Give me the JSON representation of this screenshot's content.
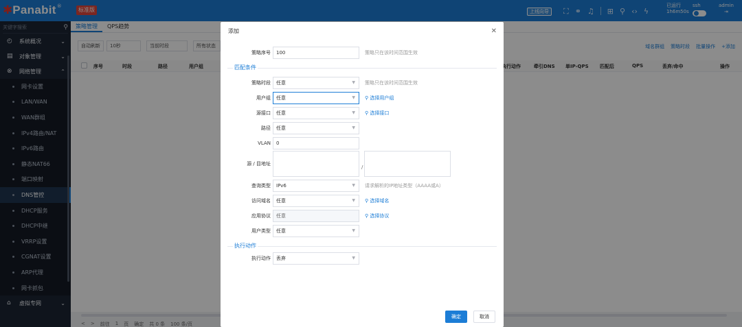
{
  "topbar": {
    "brand": "Panabit",
    "edition": "标准版",
    "guide": "上线向导",
    "icons": [
      "expand-icon",
      "link-icon",
      "bell-icon",
      "apps-icon",
      "user-group-icon",
      "code-icon",
      "flash-icon"
    ],
    "runtime_label": "已运行",
    "runtime_value": "1h6m50s",
    "ssh_label": "ssh",
    "user": "admin",
    "colors": {
      "bar": "#1c7dd6",
      "edition_badge": "#e0463c",
      "logo_star": "#e6372f"
    }
  },
  "sidebar": {
    "search_placeholder": "关键字搜索",
    "groups": [
      {
        "label": "系统概况",
        "icon": "dashboard-icon"
      },
      {
        "label": "对象管理",
        "icon": "database-icon"
      },
      {
        "label": "网络管理",
        "icon": "network-icon"
      }
    ],
    "items": [
      "网卡设置",
      "LAN/WAN",
      "WAN群组",
      "IPv4路由/NAT",
      "IPv6路由",
      "静态NAT66",
      "端口映射",
      "DNS管控",
      "DHCP服务",
      "DHCP中继",
      "VRRP设置",
      "CGNAT设置",
      "ARP代理",
      "网卡抓包"
    ],
    "active_item": "DNS管控",
    "bottom_group": {
      "label": "虚拟专网",
      "icon": "vpn-icon"
    }
  },
  "main": {
    "tabs": [
      "策略管理",
      "QPS趋势"
    ],
    "toolbar": {
      "auto_refresh": "自动刷新",
      "interval": "10秒",
      "time_filter": "当前时段",
      "status_filter": "所有状态",
      "domain_group": "域名群组",
      "policy_period": "策略时段",
      "batch": "批量操作",
      "add": "+添加"
    },
    "columns": [
      "序号",
      "时段",
      "路径",
      "用户组",
      "执行动作",
      "牵引DNS",
      "单IP-QPS",
      "匹配后",
      "QPS",
      "丢弃/命中",
      "操作"
    ],
    "pager": {
      "prev": "<",
      "next": ">",
      "goto": "前往",
      "page": "1",
      "unit": "页",
      "confirm": "确定",
      "total": "共 0 条",
      "per_page": "100 条/页"
    }
  },
  "modal": {
    "title": "添加",
    "priority_label": "策略序号",
    "priority_value": "100",
    "priority_hint": "策略只在该时间范围生效",
    "match_section": "匹配条件",
    "period_label": "策略时段",
    "period_value": "任意",
    "period_hint": "策略只在该时间范围生效",
    "usergroup_label": "用户组",
    "usergroup_value": "任意",
    "usergroup_link": "选择用户组",
    "src_if_label": "源接口",
    "src_if_value": "任意",
    "src_if_link": "选择接口",
    "path_label": "路径",
    "path_value": "任意",
    "vlan_label": "VLAN",
    "vlan_value": "0",
    "addr_label": "源 / 目地址",
    "addr_sep": "/",
    "qtype_label": "查询类型",
    "qtype_value": "IPv6",
    "qtype_hint": "请求解析的IP地址类型（AAAA或A）",
    "domain_label": "访问域名",
    "domain_value": "任意",
    "domain_link": "选择域名",
    "proto_label": "应用协议",
    "proto_value": "任意",
    "proto_link": "选择协议",
    "utype_label": "用户类型",
    "utype_value": "任意",
    "action_section": "执行动作",
    "action_label": "执行动作",
    "action_value": "丢弃",
    "ok": "确定",
    "cancel": "取消"
  }
}
